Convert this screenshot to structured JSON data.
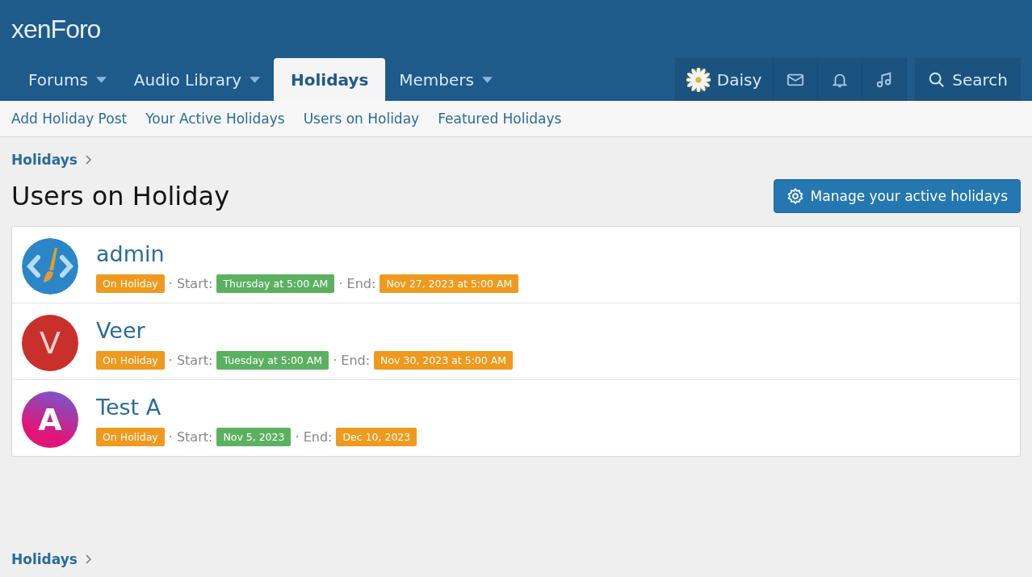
{
  "logo": "xenForo",
  "nav_tabs": [
    {
      "label": "Forums",
      "selected": false,
      "has_menu": true
    },
    {
      "label": "Audio Library",
      "selected": false,
      "has_menu": true
    },
    {
      "label": "Holidays",
      "selected": true,
      "has_menu": false
    },
    {
      "label": "Members",
      "selected": false,
      "has_menu": true
    }
  ],
  "user_nav": {
    "username": "Daisy",
    "search": "Search"
  },
  "sub_nav": [
    "Add Holiday Post",
    "Your Active Holidays",
    "Users on Holiday",
    "Featured Holidays"
  ],
  "breadcrumb": "Holidays",
  "page_title": "Users on Holiday",
  "manage_button": "Manage your active holidays",
  "users": [
    {
      "name": "admin",
      "avatar": {
        "kind": "brush",
        "color": "#2b86c8"
      },
      "meta": [
        {
          "kind": "badge",
          "text": "On Holiday",
          "color": "#ef9a1e"
        },
        {
          "kind": "label",
          "text": "· Start:"
        },
        {
          "kind": "badge",
          "text": "Thursday at 5:00 AM",
          "color": "#5cb160"
        },
        {
          "kind": "label",
          "text": "· End:"
        },
        {
          "kind": "badge",
          "text": "Nov 27, 2023 at 5:00 AM",
          "color": "#ef9a1e"
        }
      ]
    },
    {
      "name": "Veer",
      "avatar": {
        "kind": "letter",
        "letter": "V",
        "color": "#c9302c"
      },
      "meta": [
        {
          "kind": "badge",
          "text": "On Holiday",
          "color": "#ef9a1e"
        },
        {
          "kind": "label",
          "text": "· Start:"
        },
        {
          "kind": "badge",
          "text": "Tuesday at 5:00 AM",
          "color": "#5cb160"
        },
        {
          "kind": "label",
          "text": "· End:"
        },
        {
          "kind": "badge",
          "text": "Nov 30, 2023 at 5:00 AM",
          "color": "#ef9a1e"
        }
      ]
    },
    {
      "name": "Test A",
      "avatar": {
        "kind": "gradient",
        "letter": "A",
        "color": "#e0157a"
      },
      "meta": [
        {
          "kind": "badge",
          "text": "On Holiday",
          "color": "#ef9a1e"
        },
        {
          "kind": "label",
          "text": "· Start:"
        },
        {
          "kind": "badge",
          "text": "Nov 5, 2023",
          "color": "#5cb160"
        },
        {
          "kind": "label",
          "text": "· End:"
        },
        {
          "kind": "badge",
          "text": "Dec 10, 2023",
          "color": "#ef9a1e"
        }
      ]
    }
  ],
  "footer_breadcrumb": "Holidays"
}
